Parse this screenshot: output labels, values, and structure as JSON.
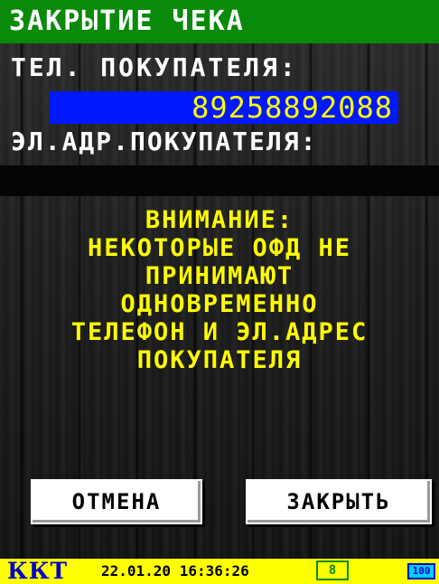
{
  "header": {
    "title": "ЗАКРЫТИЕ ЧЕКА"
  },
  "form": {
    "phone_label": "ТЕЛ. ПОКУПАТЕЛЯ:",
    "phone_value": "89258892088",
    "email_label": "ЭЛ.АДР.ПОКУПАТЕЛЯ:",
    "email_value": ""
  },
  "warning": {
    "lines": [
      "ВНИМАНИЕ:",
      "НЕКОТОРЫЕ ОФД НЕ",
      "ПРИНИМАЮТ",
      "ОДНОВРЕМЕННО",
      "ТЕЛЕФОН И ЭЛ.АДРЕС",
      "ПОКУПАТЕЛЯ"
    ]
  },
  "buttons": {
    "cancel_label": "ОТМЕНА",
    "close_label": "ЗАКРЫТЬ"
  },
  "status_bar": {
    "device_label": "ККТ",
    "datetime": "22.01.20 16:36:26",
    "counter": "8",
    "battery": "100"
  },
  "colors": {
    "title_bar": "#0a8a0a",
    "phone_field_bg": "#0018ff",
    "phone_text": "#ffff00",
    "warning_text": "#ffff00",
    "status_bar_bg": "#ffff00"
  }
}
